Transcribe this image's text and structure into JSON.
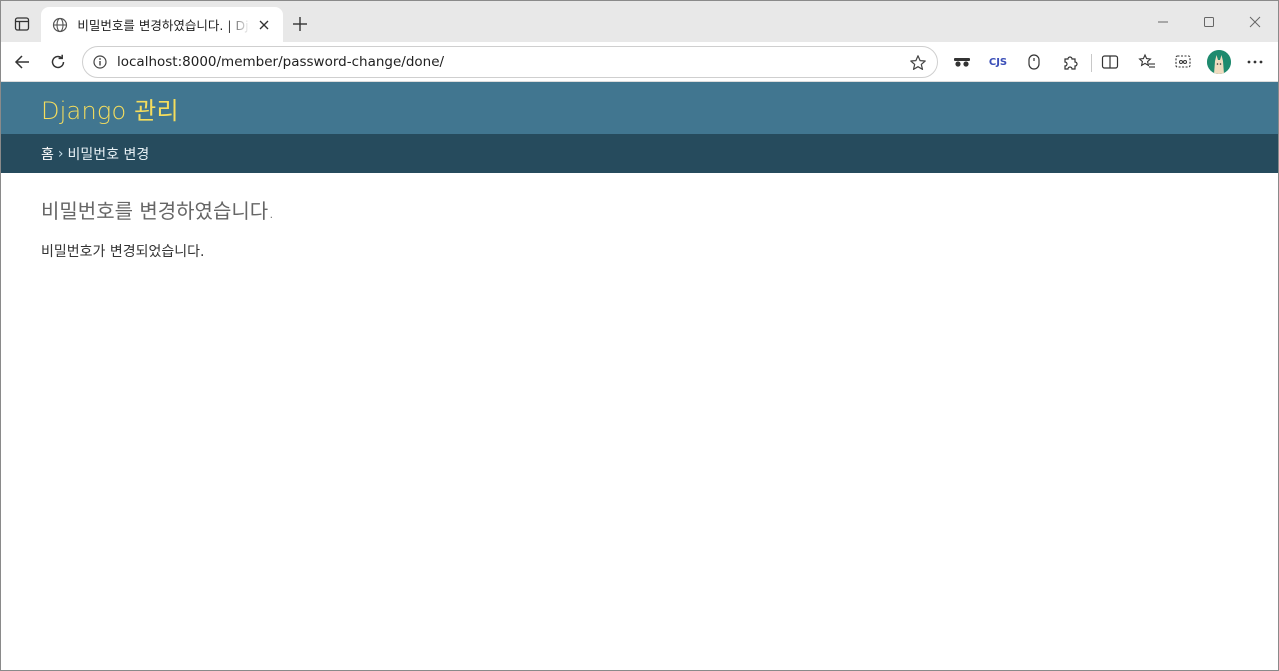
{
  "browser": {
    "tab": {
      "title": "비밀번호를 변경하였습니다. | Django 사이트 관리"
    },
    "address_bar": {
      "url": "localhost:8000/member/password-change/done/"
    },
    "extensions": {
      "cjs_label": "CJS"
    }
  },
  "page": {
    "branding": "Django 관리",
    "breadcrumbs": {
      "home": "홈",
      "separator": "›",
      "current": "비밀번호 변경"
    },
    "heading": "비밀번호를 변경하였습니다.",
    "message": "비밀번호가 변경되었습니다."
  },
  "colors": {
    "header_bg": "#417690",
    "branding_text": "#f5dd5d",
    "breadcrumbs_bg": "#264b5d",
    "heading_text": "#666666"
  }
}
